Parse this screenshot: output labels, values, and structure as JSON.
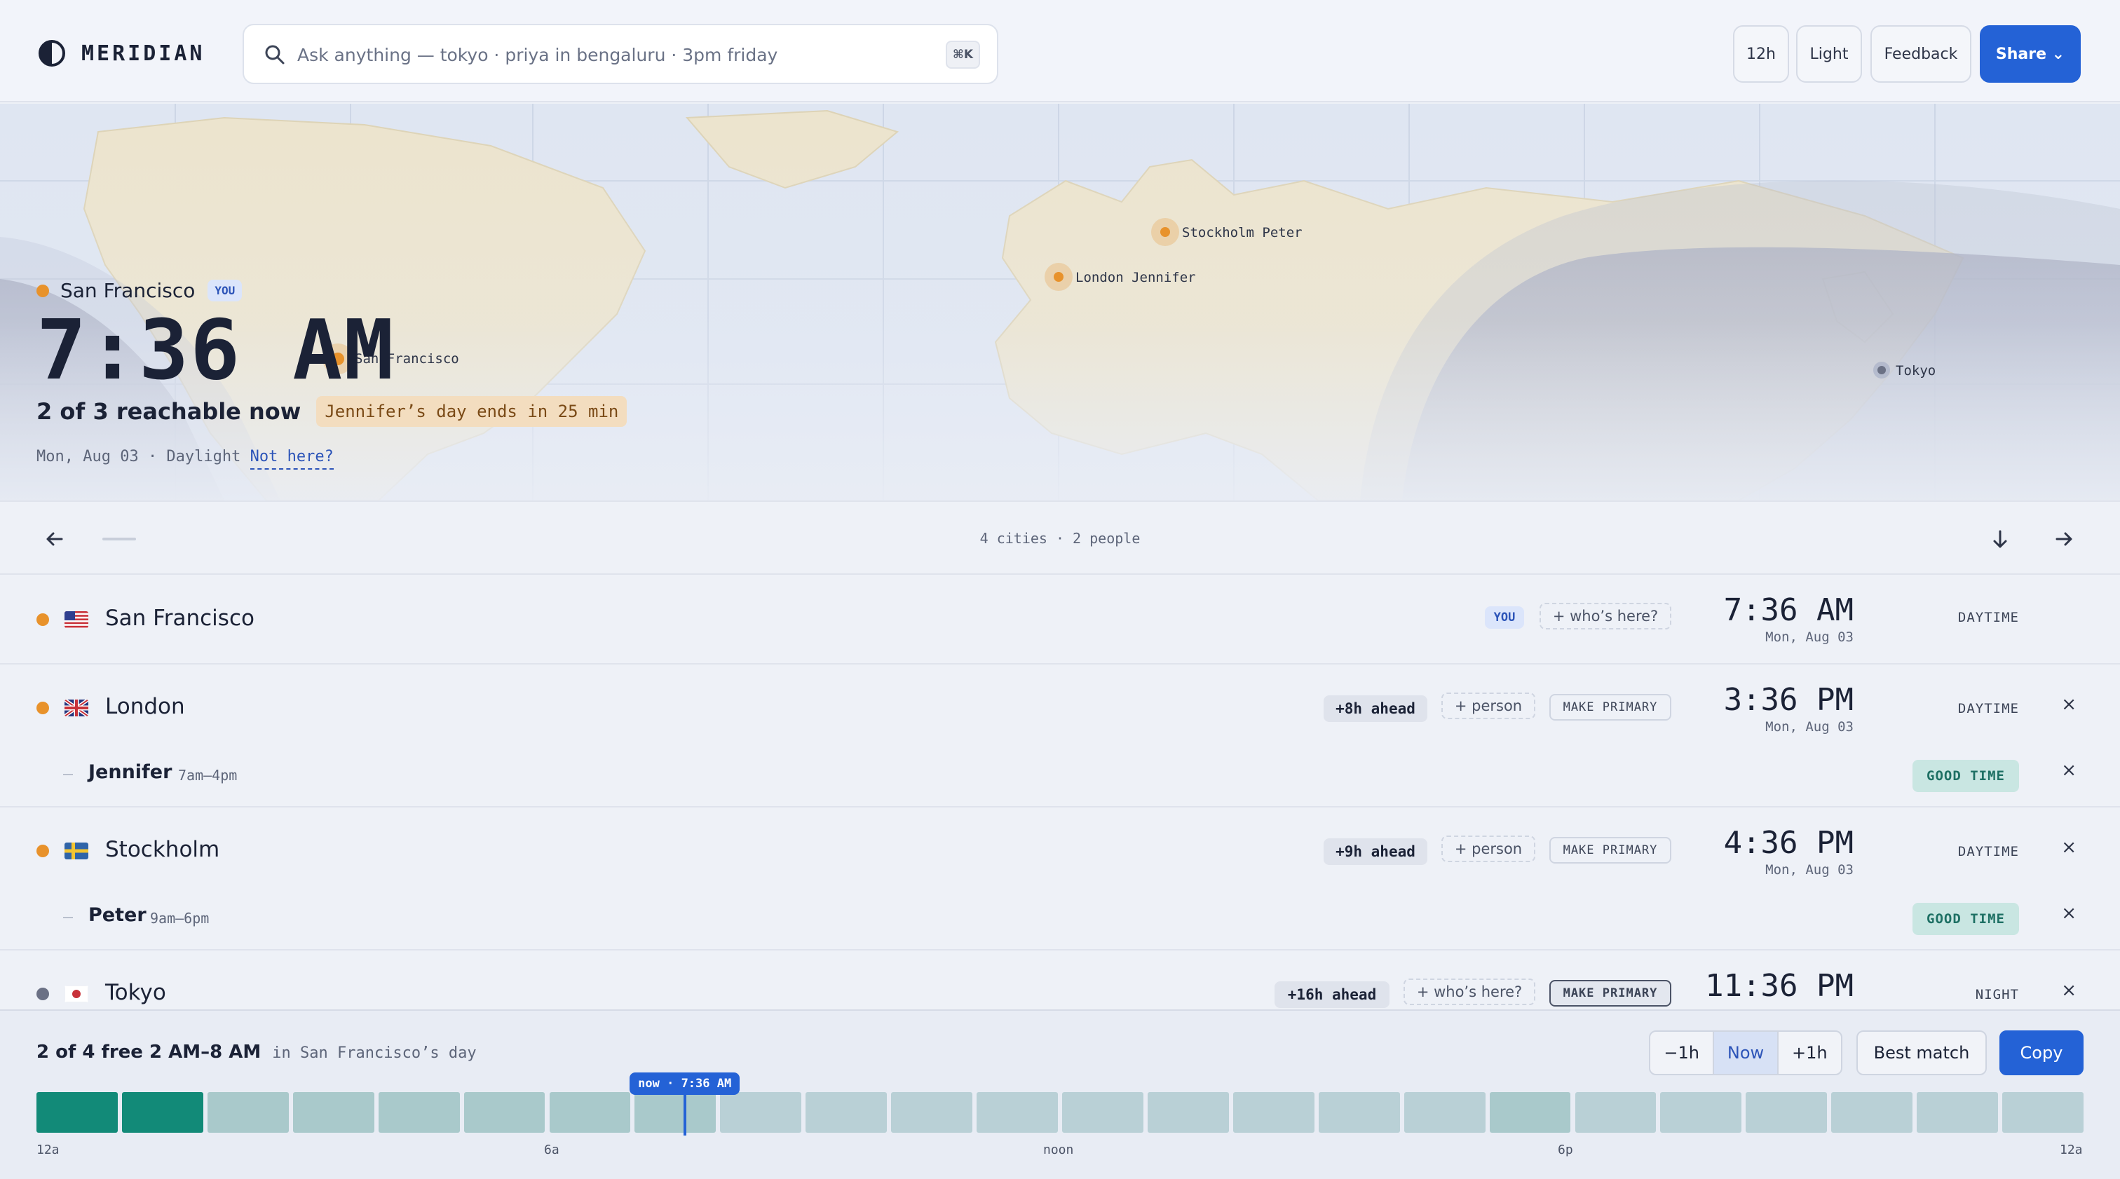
{
  "header": {
    "brand": "MERIDIAN",
    "search_placeholder": "Ask anything — tokyo · priya in bengaluru · 3pm friday",
    "search_shortcut": "⌘K",
    "buttons": {
      "clock_format": "12h",
      "theme": "Light",
      "feedback": "Feedback",
      "share": "Share ⌄"
    }
  },
  "hero": {
    "city": "San Francisco",
    "you_badge": "YOU",
    "time": "7:36 AM",
    "reachable": "2 of 3 reachable now",
    "notice": "Jennifer’s day ends in 25 min",
    "date_line": "Mon, Aug 03 · Daylight",
    "not_here": "Not here?",
    "markers": {
      "san_francisco": "San Francisco",
      "london": "London Jennifer",
      "stockholm": "Stockholm Peter",
      "tokyo": "Tokyo"
    }
  },
  "toolbar": {
    "summary": "4 cities · 2 people"
  },
  "cities": [
    {
      "name": "San Francisco",
      "you_badge": "YOU",
      "add_label": "+ who’s here?",
      "time": "7:36 AM",
      "date": "Mon, Aug 03",
      "period": "DAYTIME"
    },
    {
      "name": "London",
      "offset": "+8h ahead",
      "add_label": "+ person",
      "make_primary": "MAKE PRIMARY",
      "time": "3:36 PM",
      "date": "Mon, Aug 03",
      "period": "DAYTIME",
      "close": "×",
      "person": {
        "name": "Jennifer",
        "hours": "7am–4pm",
        "status": "GOOD TIME",
        "close": "×"
      }
    },
    {
      "name": "Stockholm",
      "offset": "+9h ahead",
      "add_label": "+ person",
      "make_primary": "MAKE PRIMARY",
      "time": "4:36 PM",
      "date": "Mon, Aug 03",
      "period": "DAYTIME",
      "close": "×",
      "person": {
        "name": "Peter",
        "hours": "9am–6pm",
        "status": "GOOD TIME",
        "close": "×"
      }
    },
    {
      "name": "Tokyo",
      "offset": "+16h ahead",
      "add_label": "+ who’s here?",
      "make_primary": "MAKE PRIMARY",
      "time": "11:36 PM",
      "period": "NIGHT",
      "close": "×"
    }
  ],
  "bottom": {
    "free_main": "2 of 4 free 2 AM–8 AM",
    "free_sub": "in San Francisco’s day",
    "minus": "−1h",
    "now": "Now",
    "plus": "+1h",
    "best": "Best match",
    "copy": "Copy",
    "now_tag": "now · 7:36 AM",
    "ticks": [
      "12a",
      "6a",
      "noon",
      "6p",
      "12a"
    ],
    "colors": {
      "strong": "#128a78",
      "medium": "#a9c9cb",
      "light": "#b9d0d6"
    },
    "slots": [
      "strong",
      "strong",
      "medium",
      "medium",
      "medium",
      "medium",
      "medium",
      "medium",
      "light",
      "light",
      "light",
      "light",
      "light",
      "light",
      "light",
      "light",
      "light",
      "medium",
      "light",
      "light",
      "light",
      "light",
      "light",
      "light"
    ],
    "now_hour": 7.6
  },
  "colors": {
    "accent": "#2462d6",
    "day_dot": "#e8922b",
    "night_dot": "#6b7185"
  }
}
